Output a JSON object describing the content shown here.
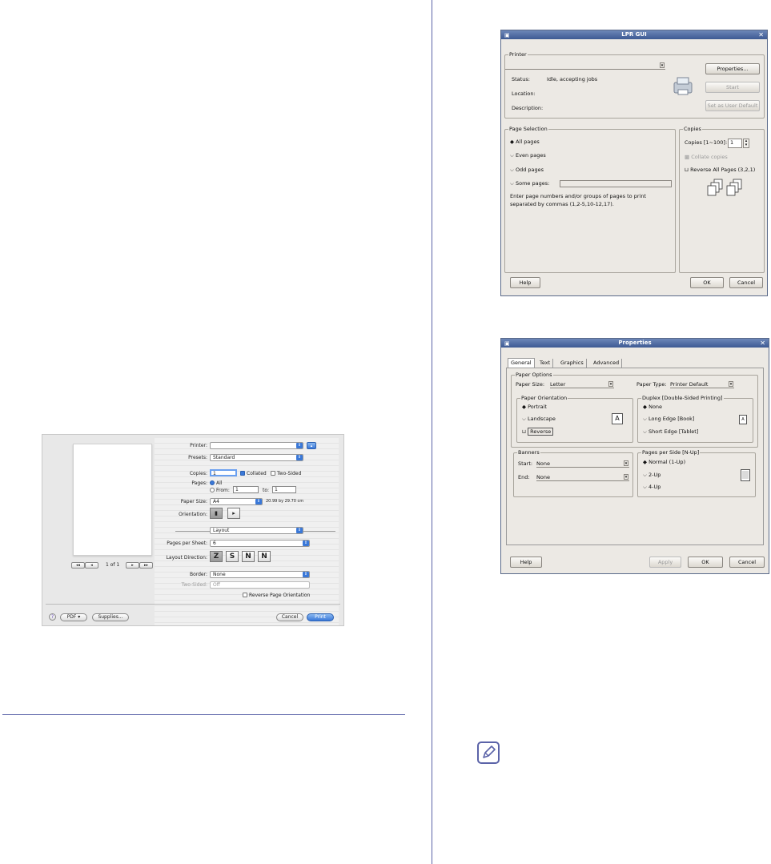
{
  "mac_print": {
    "printer_label": "Printer:",
    "printer_value": "",
    "presets_label": "Presets:",
    "presets_value": "Standard",
    "copies_label": "Copies:",
    "copies_value": "1",
    "collated_label": "Collated",
    "two_sided_label": "Two-Sided",
    "pages_label": "Pages:",
    "pages_all_label": "All",
    "pages_from_label": "From:",
    "pages_from_value": "1",
    "pages_to_label": "to:",
    "pages_to_value": "1",
    "paper_size_label": "Paper Size:",
    "paper_size_value": "A4",
    "paper_size_dims": "20.99 by 29.70 cm",
    "orientation_label": "Orientation:",
    "section_value": "Layout",
    "pages_per_sheet_label": "Pages per Sheet:",
    "pages_per_sheet_value": "6",
    "layout_direction_label": "Layout Direction:",
    "layout_dirs": [
      "Z",
      "S",
      "N",
      "N"
    ],
    "border_label": "Border:",
    "border_value": "None",
    "two_sided_field_label": "Two-Sided:",
    "two_sided_field_value": "Off",
    "reverse_label": "Reverse Page Orientation",
    "page_counter": "1 of 1",
    "nav_first": "◂◂",
    "nav_prev": "◂",
    "nav_next": "▸",
    "nav_last": "▸▸",
    "help": "?",
    "pdf_button": "PDF ▾",
    "supplies_button": "Supplies...",
    "cancel_button": "Cancel",
    "print_button": "Print"
  },
  "lpr": {
    "title": "LPR GUI",
    "printer_group": "Printer",
    "status_label": "Status:",
    "status_value": "Idle, accepting jobs",
    "location_label": "Location:",
    "description_label": "Description:",
    "properties_button": "Properties...",
    "start_button": "Start",
    "default_button": "Set as User Default",
    "page_selection_group": "Page Selection",
    "all_pages": "All pages",
    "even_pages": "Even pages",
    "odd_pages": "Odd pages",
    "some_pages": "Some pages:",
    "hint": "Enter page numbers and/or groups of pages to print separated by commas (1,2-5,10-12,17).",
    "copies_group": "Copies",
    "copies_label": "Copies [1~100]:",
    "copies_value": "1",
    "collate": "Collate copies",
    "reverse_all": "Reverse All Pages (3,2,1)",
    "help_button": "Help",
    "ok_button": "OK",
    "cancel_button": "Cancel"
  },
  "props": {
    "title": "Properties",
    "tabs": [
      "General",
      "Text",
      "Graphics",
      "Advanced"
    ],
    "paper_options_group": "Paper Options",
    "paper_size_label": "Paper Size:",
    "paper_size_value": "Letter",
    "paper_type_label": "Paper Type:",
    "paper_type_value": "Printer Default",
    "orientation_group": "Paper Orientation",
    "portrait": "Portrait",
    "landscape": "Landscape",
    "reverse": "Reverse",
    "duplex_group": "Duplex [Double-Sided Printing]",
    "duplex_none": "None",
    "long_edge": "Long Edge [Book]",
    "short_edge": "Short Edge [Tablet]",
    "banners_group": "Banners",
    "start_label": "Start:",
    "start_value": "None",
    "end_label": "End:",
    "end_value": "None",
    "nup_group": "Pages per Side [N-Up]",
    "normal": "Normal (1-Up)",
    "two_up": "2-Up",
    "four_up": "4-Up",
    "help_button": "Help",
    "apply_button": "Apply",
    "ok_button": "OK",
    "cancel_button": "Cancel"
  }
}
